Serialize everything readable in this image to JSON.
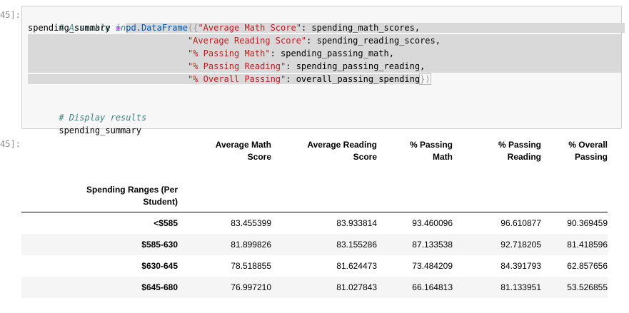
{
  "input_prompt": "45]:",
  "output_prompt": "45]:",
  "code": {
    "comment1": "# Assemble into DataFrame",
    "line2_var": "spending_summary",
    "line2_eq": " = ",
    "line2_obj": "pd.DataFrame",
    "line2_open": "({",
    "line2_key": "\"Average Math Score\"",
    "line2_val": ": spending_math_scores,",
    "line3_indent": "                               ",
    "line3_key": "\"Average Reading Score\"",
    "line3_val": ": spending_reading_scores,",
    "line4_key": "\"% Passing Math\"",
    "line4_val": ": spending_passing_math,",
    "line5_key": "\"% Passing Reading\"",
    "line5_val": ": spending_passing_reading,",
    "line6_key": "\"% Overall Passing\"",
    "line6_val": ": overall_passing_spending",
    "line6_close": "})",
    "comment2": "# Display results",
    "line9": "spending_summary"
  },
  "table": {
    "columns": [
      "Average Math Score",
      "Average Reading Score",
      "% Passing Math",
      "% Passing Reading",
      "% Overall Passing"
    ],
    "columns_line1": [
      "Average Math",
      "Average Reading",
      "% Passing",
      "% Passing",
      "% Overall"
    ],
    "columns_line2": [
      "Score",
      "Score",
      "Math",
      "Reading",
      "Passing"
    ],
    "index_name_line1": "Spending Ranges (Per",
    "index_name_line2": "Student)",
    "rows": [
      {
        "index": "<$585",
        "values": [
          "83.455399",
          "83.933814",
          "93.460096",
          "96.610877",
          "90.369459"
        ]
      },
      {
        "index": "$585-630",
        "values": [
          "81.899826",
          "83.155286",
          "87.133538",
          "92.718205",
          "81.418596"
        ]
      },
      {
        "index": "$630-645",
        "values": [
          "78.518855",
          "81.624473",
          "73.484209",
          "84.391793",
          "62.857656"
        ]
      },
      {
        "index": "$645-680",
        "values": [
          "76.997210",
          "81.027843",
          "66.164813",
          "81.133951",
          "53.526855"
        ]
      }
    ]
  }
}
